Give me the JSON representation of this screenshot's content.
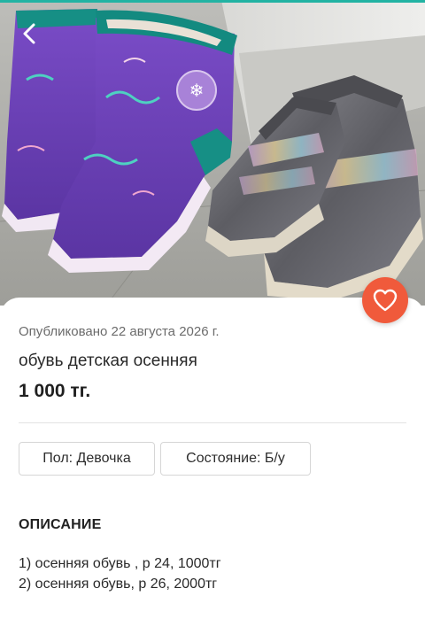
{
  "icons": {
    "back": "chevron-left-icon",
    "favorite": "heart-icon"
  },
  "colors": {
    "favorite_button": "#f05a3b",
    "photo_boots": "#6b3fb5",
    "photo_sneakers": "#6e6e72"
  },
  "listing": {
    "published": "Опубликовано 22 августа 2026 г.",
    "title": "обувь детская осенняя",
    "price": "1 000 тг.",
    "attributes": [
      {
        "label": "Пол: Девочка"
      },
      {
        "label": "Состояние: Б/у"
      }
    ],
    "description_heading": "ОПИСАНИЕ",
    "description_lines": [
      "1) осенняя обувь , р 24, 1000тг",
      "2) осенняя обувь, р 26, 2000тг"
    ]
  }
}
